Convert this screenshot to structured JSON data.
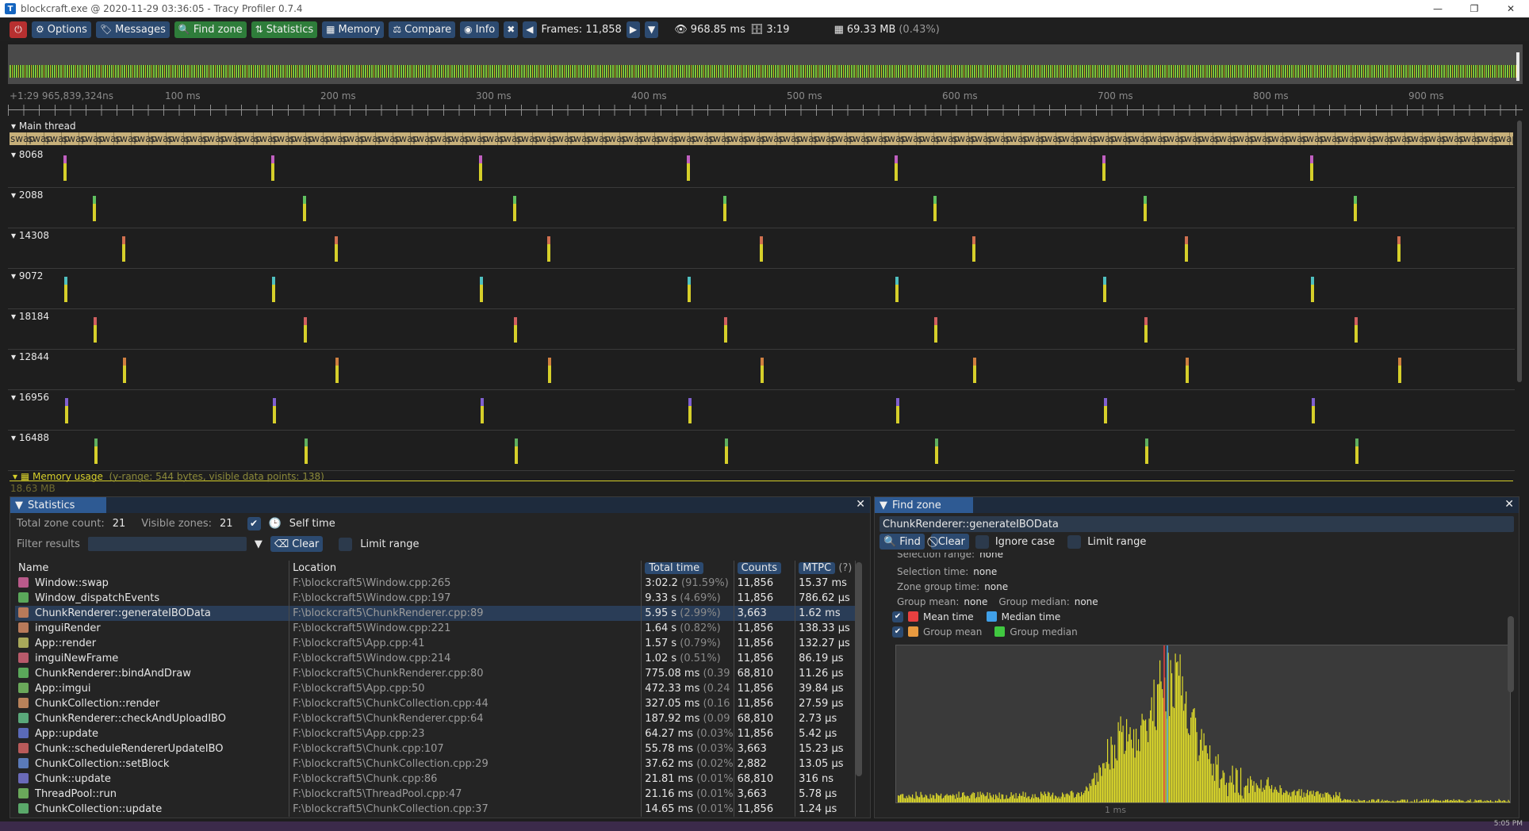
{
  "window": {
    "title": "blockcraft.exe @ 2020-11-29 03:36:05 - Tracy Profiler 0.7.4",
    "app_icon": "T",
    "minimize": "—",
    "maximize": "❐",
    "close": "✕"
  },
  "toolbar": {
    "power_icon": "⏻",
    "options": "Options",
    "messages": "Messages",
    "find_zone": "Find zone",
    "statistics": "Statistics",
    "memory": "Memory",
    "compare": "Compare",
    "info": "Info",
    "tools_icon": "✖",
    "prev_icon": "◀",
    "frames": "Frames: 11,858",
    "next_icon": "▶",
    "dropdown_icon": "▼",
    "view_time": "968.85 ms",
    "db_time": "3:19",
    "mem": "69.33 MB",
    "mem_pct": "(0.43%)"
  },
  "ruler": {
    "origin": "+1:29 965,839,324ns",
    "ticks": [
      "100 ms",
      "200 ms",
      "300 ms",
      "400 ms",
      "500 ms",
      "600 ms",
      "700 ms",
      "800 ms",
      "900 ms"
    ]
  },
  "timeline": {
    "main_thread": "Main thread",
    "swap_label": "swap",
    "lanes": [
      "8068",
      "2088",
      "14308",
      "9072",
      "18184",
      "12844",
      "16956",
      "16488"
    ],
    "memory_usage": "Memory usage",
    "memory_meta": "(y-range: 544 bytes, visible data points: 138)",
    "memory_size": "18.63 MB"
  },
  "statistics": {
    "tab": "Statistics",
    "close": "✕",
    "total_zone_label": "Total zone count:",
    "total_zone_value": "21",
    "visible_zone_label": "Visible zones:",
    "visible_zone_value": "21",
    "self_time": "Self time",
    "filter_label": "Filter results",
    "clear": "Clear",
    "limit_range": "Limit range",
    "columns": [
      "Name",
      "Location",
      "Total time",
      "Counts",
      "MTPC",
      "(?)"
    ],
    "rows": [
      {
        "name": "Window::swap",
        "loc": "F:\\blockcraft5\\Window.cpp:265",
        "total": "3:02.2",
        "pct": "(91.59%)",
        "count": "11,856",
        "mtpc": "15.37 ms",
        "color": "#b85a8a"
      },
      {
        "name": "Window_dispatchEvents",
        "loc": "F:\\blockcraft5\\Window.cpp:197",
        "total": "9.33 s",
        "pct": "(4.69%)",
        "count": "11,856",
        "mtpc": "786.62 μs",
        "color": "#5aa85a"
      },
      {
        "name": "ChunkRenderer::generateIBOData",
        "loc": "F:\\blockcraft5\\ChunkRenderer.cpp:89",
        "total": "5.95 s",
        "pct": "(2.99%)",
        "count": "3,663",
        "mtpc": "1.62 ms",
        "color": "#b87a5a"
      },
      {
        "name": "imguiRender",
        "loc": "F:\\blockcraft5\\Window.cpp:221",
        "total": "1.64 s",
        "pct": "(0.82%)",
        "count": "11,856",
        "mtpc": "138.33 μs",
        "color": "#b87a5a"
      },
      {
        "name": "App::render",
        "loc": "F:\\blockcraft5\\App.cpp:41",
        "total": "1.57 s",
        "pct": "(0.79%)",
        "count": "11,856",
        "mtpc": "132.27 μs",
        "color": "#a8a85a"
      },
      {
        "name": "imguiNewFrame",
        "loc": "F:\\blockcraft5\\Window.cpp:214",
        "total": "1.02 s",
        "pct": "(0.51%)",
        "count": "11,856",
        "mtpc": "86.19 μs",
        "color": "#b85a6a"
      },
      {
        "name": "ChunkRenderer::bindAndDraw",
        "loc": "F:\\blockcraft5\\ChunkRenderer.cpp:80",
        "total": "775.08 ms",
        "pct": "(0.39",
        "count": "68,810",
        "mtpc": "11.26 μs",
        "color": "#5aa85a"
      },
      {
        "name": "App::imgui",
        "loc": "F:\\blockcraft5\\App.cpp:50",
        "total": "472.33 ms",
        "pct": "(0.24",
        "count": "11,856",
        "mtpc": "39.84 μs",
        "color": "#6aa85a"
      },
      {
        "name": "ChunkCollection::render",
        "loc": "F:\\blockcraft5\\ChunkCollection.cpp:44",
        "total": "327.05 ms",
        "pct": "(0.16",
        "count": "11,856",
        "mtpc": "27.59 μs",
        "color": "#b8825a"
      },
      {
        "name": "ChunkRenderer::checkAndUploadIBO",
        "loc": "F:\\blockcraft5\\ChunkRenderer.cpp:64",
        "total": "187.92 ms",
        "pct": "(0.09",
        "count": "68,810",
        "mtpc": "2.73 μs",
        "color": "#5aa87a"
      },
      {
        "name": "App::update",
        "loc": "F:\\blockcraft5\\App.cpp:23",
        "total": "64.27 ms",
        "pct": "(0.03%",
        "count": "11,856",
        "mtpc": "5.42 μs",
        "color": "#5a6ab8"
      },
      {
        "name": "Chunk::scheduleRendererUpdateIBO",
        "loc": "F:\\blockcraft5\\Chunk.cpp:107",
        "total": "55.78 ms",
        "pct": "(0.03%",
        "count": "3,663",
        "mtpc": "15.23 μs",
        "color": "#b85a5a"
      },
      {
        "name": "ChunkCollection::setBlock",
        "loc": "F:\\blockcraft5\\ChunkCollection.cpp:29",
        "total": "37.62 ms",
        "pct": "(0.02%",
        "count": "2,882",
        "mtpc": "13.05 μs",
        "color": "#5a7ab8"
      },
      {
        "name": "Chunk::update",
        "loc": "F:\\blockcraft5\\Chunk.cpp:86",
        "total": "21.81 ms",
        "pct": "(0.01%",
        "count": "68,810",
        "mtpc": "316 ns",
        "color": "#6a6ab8"
      },
      {
        "name": "ThreadPool::run",
        "loc": "F:\\blockcraft5\\ThreadPool.cpp:47",
        "total": "21.16 ms",
        "pct": "(0.01%",
        "count": "3,663",
        "mtpc": "5.78 μs",
        "color": "#6aa85a"
      },
      {
        "name": "ChunkCollection::update",
        "loc": "F:\\blockcraft5\\ChunkCollection.cpp:37",
        "total": "14.65 ms",
        "pct": "(0.01%",
        "count": "11,856",
        "mtpc": "1.24 μs",
        "color": "#5aa86a"
      }
    ]
  },
  "findzone": {
    "tab": "Find zone",
    "close": "✕",
    "query": "ChunkRenderer::generateIBOData",
    "find": "Find",
    "clear": "Clear",
    "ignore_case": "Ignore case",
    "limit_range": "Limit range",
    "selection_range_label": "Selection range:",
    "selection_range_value": "none",
    "selection_time_label": "Selection time:",
    "selection_time_value": "none",
    "zone_group_label": "Zone group time:",
    "zone_group_value": "none",
    "group_mean_label": "Group mean:",
    "group_mean_value": "none",
    "group_median_label": "Group median:",
    "group_median_value": "none",
    "legend": {
      "mean": "Mean time",
      "median": "Median time",
      "group_mean": "Group mean",
      "group_median": "Group median",
      "mean_color": "#e84040",
      "median_color": "#40a0e8",
      "group_mean_color": "#e89a40",
      "group_median_color": "#40c840"
    },
    "axis_label": "1 ms"
  },
  "taskbar": {
    "clock": "5:05 PM"
  }
}
